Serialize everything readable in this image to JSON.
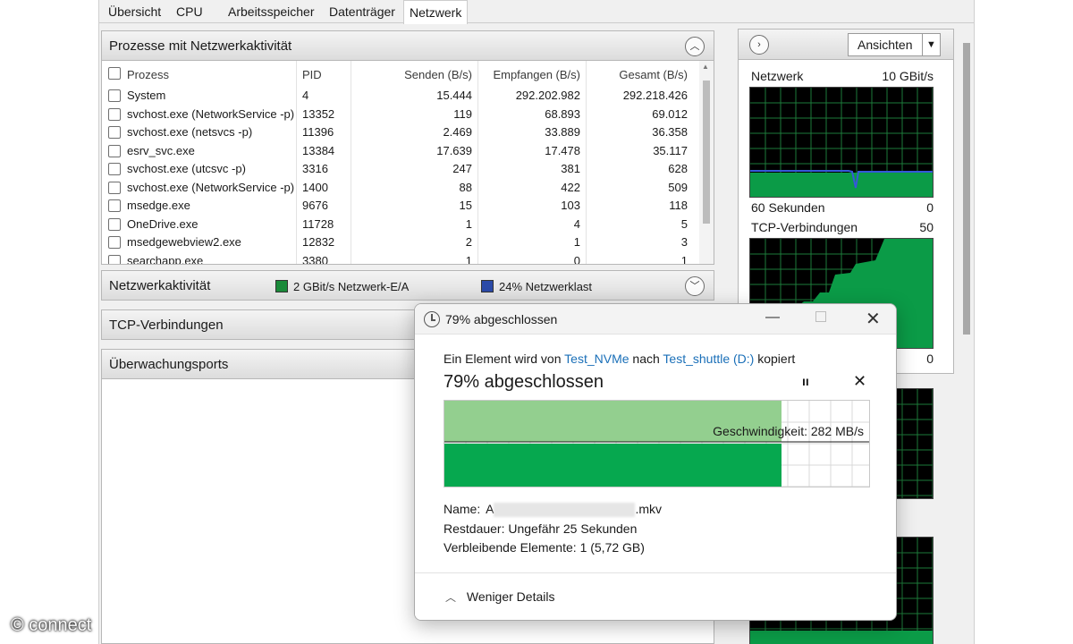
{
  "tabs": [
    {
      "label": "Übersicht",
      "active": false
    },
    {
      "label": "CPU",
      "active": false
    },
    {
      "label": "Arbeitsspeicher",
      "active": false
    },
    {
      "label": "Datenträger",
      "active": false
    },
    {
      "label": "Netzwerk",
      "active": true
    }
  ],
  "processes_section": {
    "title": "Prozesse mit Netzwerkaktivität",
    "columns": [
      "Prozess",
      "PID",
      "Senden (B/s)",
      "Empfangen (B/s)",
      "Gesamt (B/s)"
    ],
    "rows": [
      {
        "name": "System",
        "pid": "4",
        "send": "15.444",
        "recv": "292.202.982",
        "total": "292.218.426"
      },
      {
        "name": "svchost.exe (NetworkService -p)",
        "pid": "13352",
        "send": "119",
        "recv": "68.893",
        "total": "69.012"
      },
      {
        "name": "svchost.exe (netsvcs -p)",
        "pid": "11396",
        "send": "2.469",
        "recv": "33.889",
        "total": "36.358"
      },
      {
        "name": "esrv_svc.exe",
        "pid": "13384",
        "send": "17.639",
        "recv": "17.478",
        "total": "35.117"
      },
      {
        "name": "svchost.exe (utcsvc -p)",
        "pid": "3316",
        "send": "247",
        "recv": "381",
        "total": "628"
      },
      {
        "name": "svchost.exe (NetworkService -p)",
        "pid": "1400",
        "send": "88",
        "recv": "422",
        "total": "509"
      },
      {
        "name": "msedge.exe",
        "pid": "9676",
        "send": "15",
        "recv": "103",
        "total": "118"
      },
      {
        "name": "OneDrive.exe",
        "pid": "11728",
        "send": "1",
        "recv": "4",
        "total": "5"
      },
      {
        "name": "msedgewebview2.exe",
        "pid": "12832",
        "send": "2",
        "recv": "1",
        "total": "3"
      },
      {
        "name": "searchapp.exe",
        "pid": "3380",
        "send": "1",
        "recv": "0",
        "total": "1"
      }
    ]
  },
  "network_activity": {
    "title": "Netzwerkaktivität",
    "legend": [
      {
        "label": "2 GBit/s Netzwerk-E/A",
        "color": "#1a8a3a"
      },
      {
        "label": "24% Netzwerklast",
        "color": "#2b4aa8"
      }
    ]
  },
  "tcp_section": {
    "title": "TCP-Verbindungen"
  },
  "ports_section": {
    "title": "Überwachungsports"
  },
  "side_panel": {
    "views_button": "Ansichten",
    "graphs": [
      {
        "title": "Netzwerk",
        "max": "10 GBit/s",
        "time": "60 Sekunden",
        "min": "0"
      },
      {
        "title": "TCP-Verbindungen",
        "max": "50",
        "min": "0"
      }
    ]
  },
  "copy_dialog": {
    "title": "79% abgeschlossen",
    "description_prefix": "Ein Element wird von",
    "source": "Test_NVMe",
    "middle": "nach",
    "destination": "Test_shuttle (D:)",
    "description_suffix": "kopiert",
    "heading": "79% abgeschlossen",
    "progress": 0.79,
    "speed_text": "Geschwindigkeit: 282 MB/s",
    "name_label": "Name:",
    "name_visible_start": "A",
    "name_visible_end": ".mkv",
    "remaining_time_label": "Restdauer:",
    "remaining_time_value": "Ungefähr 25 Sekunden",
    "remaining_items_label": "Verbleibende Elemente:",
    "remaining_items_value": "1 (5,72 GB)",
    "less_details": "Weniger Details",
    "colors": {
      "progress_fill": "#06a84f",
      "progress_history": "#93cf8f"
    }
  },
  "watermark": "© connect"
}
